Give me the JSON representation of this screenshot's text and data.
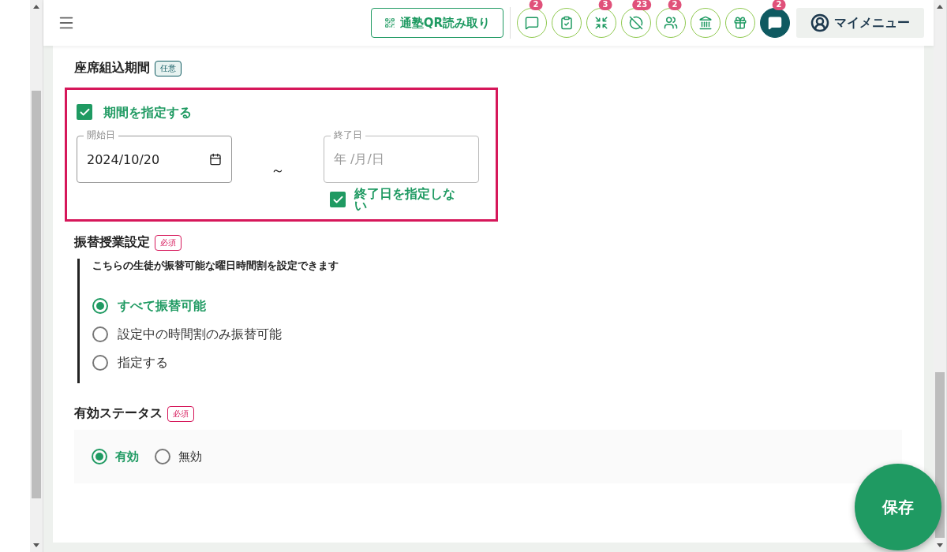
{
  "header": {
    "qr_button": "通塾QR読み取り",
    "icon_buttons": [
      {
        "badge": "2",
        "filled": false
      },
      {
        "filled": false
      },
      {
        "badge": "3",
        "filled": false
      },
      {
        "badge": "23",
        "filled": false
      },
      {
        "badge": "2",
        "filled": false
      },
      {
        "filled": false
      },
      {
        "filled": false
      },
      {
        "badge": "2",
        "filled": true
      }
    ],
    "my_menu": "マイメニュー"
  },
  "period": {
    "title": "座席組込期間",
    "tag": "任意",
    "required": false,
    "specify": {
      "label": "期間を指定する",
      "checked": true
    },
    "start": {
      "label": "開始日",
      "value": "2024/10/20"
    },
    "separator": "～",
    "end": {
      "label": "終了日",
      "placeholder": "年 /月/日"
    },
    "no_end": {
      "label": "終了日を指定しない",
      "checked": true
    }
  },
  "substitute": {
    "title": "振替授業設定",
    "tag": "必須",
    "required": true,
    "note": "こちらの生徒が振替可能な曜日時間割を設定できます",
    "options": [
      {
        "label": "すべて振替可能",
        "selected": true
      },
      {
        "label": "設定中の時間割のみ振替可能",
        "selected": false
      },
      {
        "label": "指定する",
        "selected": false
      }
    ]
  },
  "status": {
    "title": "有効ステータス",
    "tag": "必須",
    "required": true,
    "options": [
      {
        "label": "有効",
        "selected": true
      },
      {
        "label": "無効",
        "selected": false
      }
    ]
  },
  "save_button": "保存"
}
